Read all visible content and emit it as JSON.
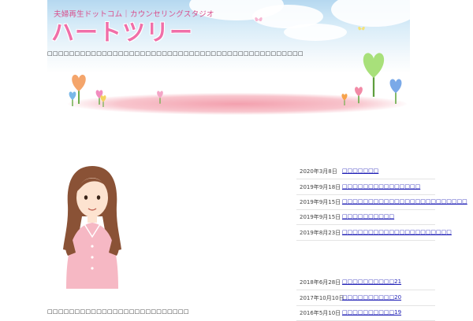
{
  "header": {
    "subtitle": "夫婦再生ドットコム｜カウンセリングスタジオ",
    "logo_text": "ハートツリー",
    "intro_line": "□□□□□□□□□□□□□□□□□□□□□□□□□□□□□□□□□□□□□□□□□□□□□□□"
  },
  "profile": {
    "caption": "□□□□□□□□□□□□□□□□□□□□□□□□□□"
  },
  "news_top": [
    {
      "date": "2020年3月8日",
      "title": "□□□□□□□"
    },
    {
      "date": "2019年9月18日",
      "title": "□□□□□□□□□□□□□□□"
    },
    {
      "date": "2019年9月15日",
      "title": "□□□□□□□□□□□□□□□□□□□□□□□□"
    },
    {
      "date": "2019年9月15日",
      "title": "□□□□□□□□□□"
    },
    {
      "date": "2019年8月23日",
      "title": "□□□□□□□□□□□□□□□□□□□□□"
    }
  ],
  "news_bottom": [
    {
      "date": "2018年6月28日",
      "title": "□□□□□□□□□□21"
    },
    {
      "date": "2017年10月10日",
      "title": "□□□□□□□□□□20"
    },
    {
      "date": "2016年5月10日",
      "title": "□□□□□□□□□□19"
    }
  ],
  "colors": {
    "logo": "#f06fa8",
    "subtitle": "#d94f8c",
    "link": "#1a1ab4",
    "sky": "#b5d8f0",
    "garden": "#f3a0ae"
  }
}
